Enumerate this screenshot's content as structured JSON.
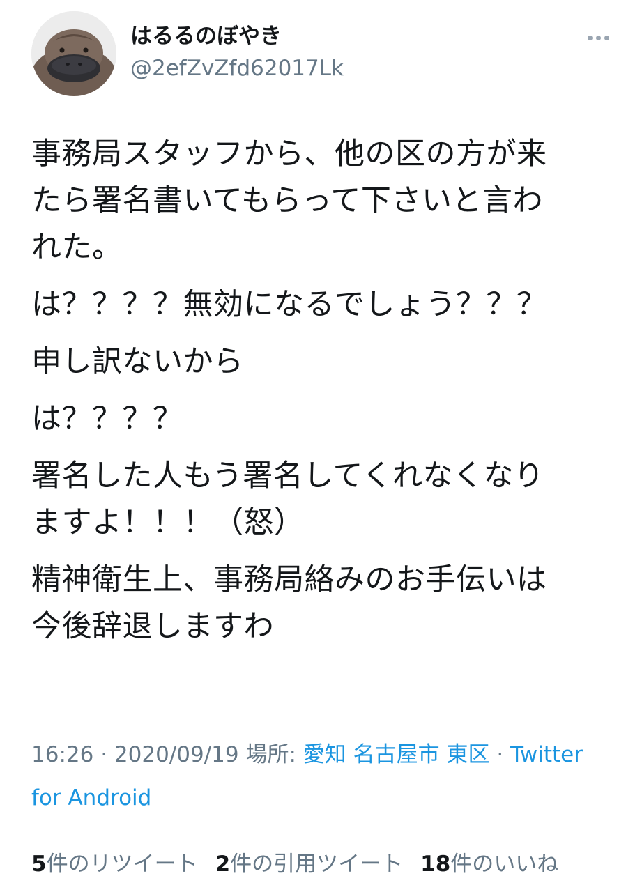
{
  "user": {
    "display_name": "はるるのぼやき",
    "handle": "@2efZvZfd62017Lk",
    "avatar_icon": "platypus-avatar"
  },
  "more_icon": "more-horizontal-icon",
  "tweet": {
    "paragraphs": [
      [
        "事務局スタッフから、他の区の方が来",
        "たら署名書いてもらって下さいと言わ",
        "れた。"
      ],
      [
        "は？？？？無効になるでしょう？？？"
      ],
      [
        "申し訳ないから"
      ],
      [
        "は？？？？"
      ],
      [
        "署名した人もう署名してくれなくなり",
        "ますよ！！！（怒）"
      ],
      [
        "精神衛生上、事務局絡みのお手伝いは",
        "今後辞退しますわ"
      ]
    ]
  },
  "meta": {
    "time": "16:26",
    "separator": "·",
    "date": "2020/09/19",
    "location_label": "場所:",
    "location": "愛知 名古屋市 東区",
    "source_part1": "Twitter",
    "source_part2": "for Android"
  },
  "stats": {
    "retweets_count": "5",
    "retweets_label": "件のリツイート",
    "quotes_count": "2",
    "quotes_label": "件の引用ツイート",
    "likes_count": "18",
    "likes_label": "件のいいね"
  },
  "colors": {
    "link": "#1b95e0",
    "secondary_text": "#657786",
    "primary_text": "#14171a"
  }
}
